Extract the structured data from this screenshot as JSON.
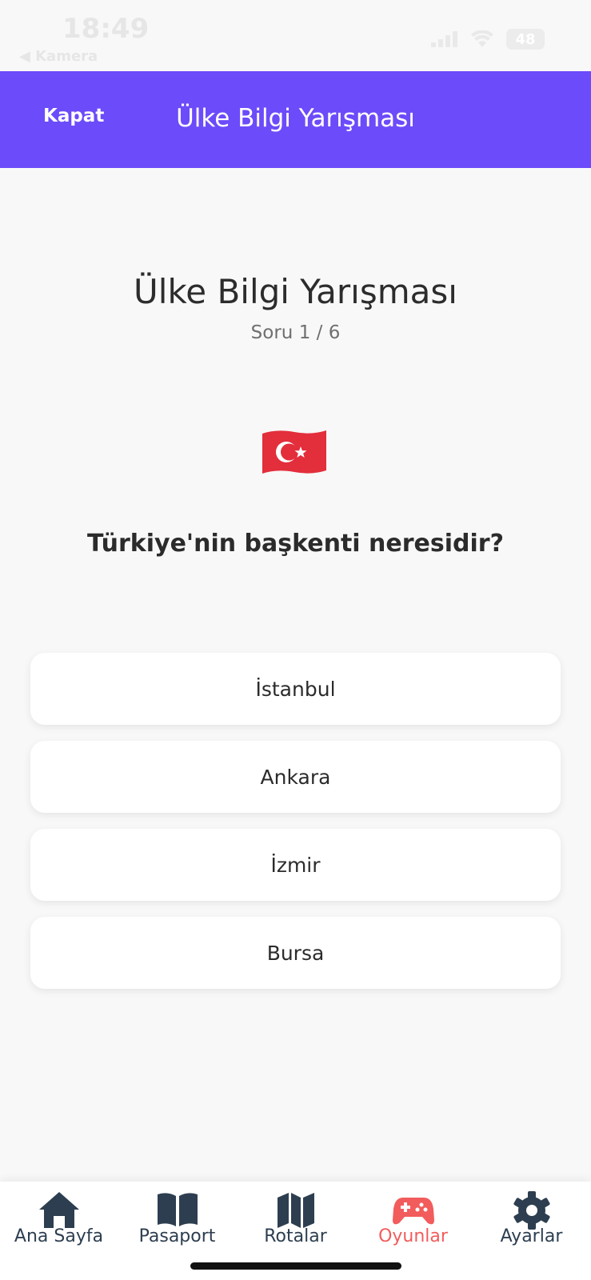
{
  "status_bar": {
    "time": "18:49",
    "back_app": "◀ Kamera",
    "battery": "48"
  },
  "header": {
    "close_label": "Kapat",
    "title": "Ülke Bilgi Yarışması"
  },
  "quiz": {
    "title": "Ülke Bilgi Yarışması",
    "progress": "Soru 1 / 6",
    "flag_icon": "turkey-flag",
    "question": "Türkiye'nin başkenti neresidir?",
    "options": [
      "İstanbul",
      "Ankara",
      "İzmir",
      "Bursa"
    ]
  },
  "tabs": [
    {
      "label": "Ana Sayfa",
      "icon": "home-icon",
      "active": false
    },
    {
      "label": "Pasaport",
      "icon": "book-icon",
      "active": false
    },
    {
      "label": "Rotalar",
      "icon": "map-icon",
      "active": false
    },
    {
      "label": "Oyunlar",
      "icon": "gamepad-icon",
      "active": true
    },
    {
      "label": "Ayarlar",
      "icon": "gear-icon",
      "active": false
    }
  ],
  "colors": {
    "header": "#6c4bfa",
    "active_tab": "#f25c5c",
    "tab_icon": "#2d3e50"
  }
}
